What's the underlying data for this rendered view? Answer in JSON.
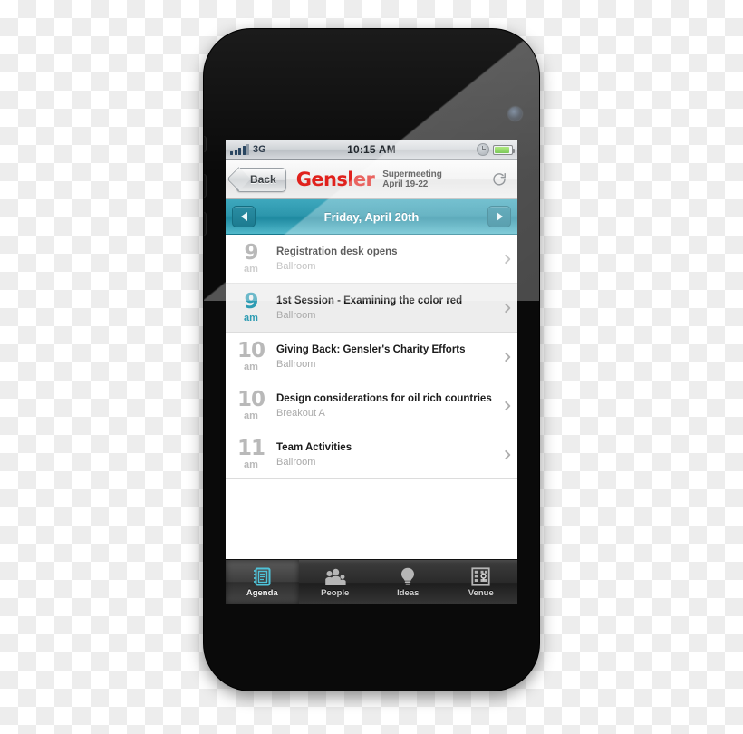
{
  "device": {
    "name": "iPhone 4",
    "hardware": {
      "camera": "front-camera",
      "speaker": "earpiece-speaker",
      "home_button": "home-button",
      "volume_up": "volume-up-button",
      "volume_down": "volume-down-button",
      "silent_switch": "silent-switch"
    }
  },
  "status_bar": {
    "carrier_network": "3G",
    "signal_bars": 4,
    "signal_bars_total": 5,
    "time": "10:15 AM",
    "alarm_icon": "alarm-clock-icon",
    "battery_icon": "battery-icon",
    "battery_color": "#5cc91e"
  },
  "nav_bar": {
    "back_label": "Back",
    "brand": "Gensler",
    "brand_color": "#e0211c",
    "event_name": "Supermeeting",
    "event_dates": "April 19-22",
    "refresh_icon": "refresh-icon"
  },
  "date_bar": {
    "prev_icon": "chevron-left-icon",
    "next_icon": "chevron-right-icon",
    "current_date": "Friday, April 20th",
    "accent_color": "#2d97ad"
  },
  "agenda": {
    "rows": [
      {
        "hour": "9",
        "meridiem": "am",
        "title": "Registration desk opens",
        "location": "Ballroom",
        "selected": false
      },
      {
        "hour": "9",
        "meridiem": "am",
        "title": "1st Session - Examining the color red",
        "location": "Ballroom",
        "selected": true
      },
      {
        "hour": "10",
        "meridiem": "am",
        "title": "Giving Back: Gensler's Charity Efforts",
        "location": "Ballroom",
        "selected": false
      },
      {
        "hour": "10",
        "meridiem": "am",
        "title": "Design considerations for oil rich countries",
        "location": "Breakout A",
        "selected": false
      },
      {
        "hour": "11",
        "meridiem": "am",
        "title": "Team Activities",
        "location": "Ballroom",
        "selected": false
      }
    ],
    "disclosure_icon": "chevron-right-icon"
  },
  "tab_bar": {
    "tabs": [
      {
        "label": "Agenda",
        "icon": "notebook-icon",
        "active": true
      },
      {
        "label": "People",
        "icon": "people-icon",
        "active": false
      },
      {
        "label": "Ideas",
        "icon": "lightbulb-icon",
        "active": false
      },
      {
        "label": "Venue",
        "icon": "building-map-icon",
        "active": false
      }
    ],
    "active_icon_color": "#4fc3d9"
  }
}
